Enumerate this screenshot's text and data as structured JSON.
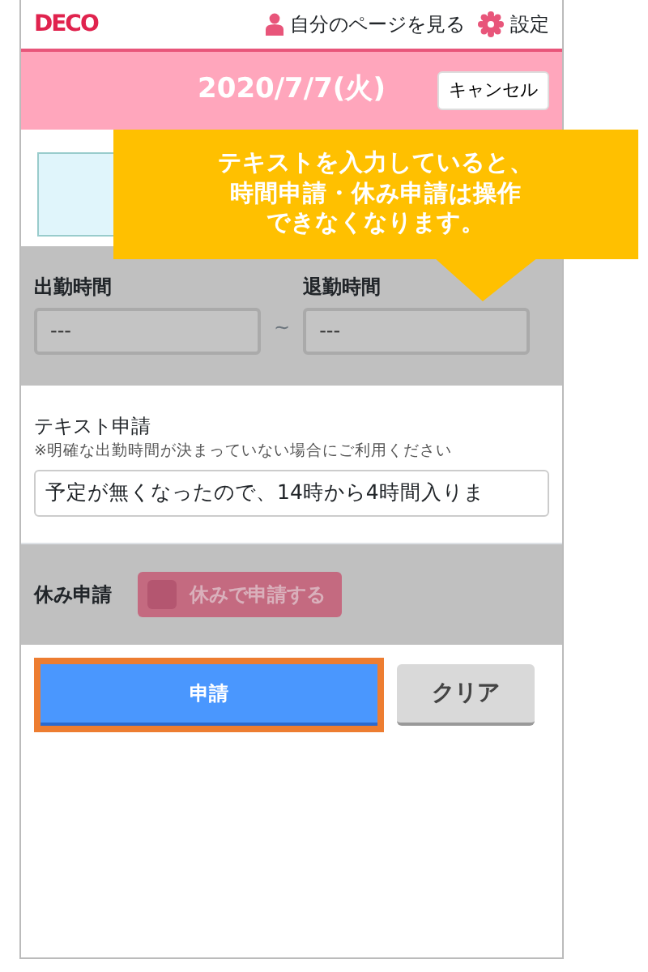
{
  "header": {
    "logo": "DECO",
    "my_page_link": "自分のページを見る",
    "settings_link": "設定"
  },
  "date_bar": {
    "date": "2020/7/7(火)",
    "cancel_button": "キャンセル"
  },
  "callout": {
    "lines": [
      "テキストを入力していると、",
      "時間申請・休み申請は操作",
      "できなくなります。"
    ]
  },
  "time_request": {
    "disabled": true,
    "start_label": "出勤時間",
    "start_value": "---",
    "separator": "~",
    "end_label": "退勤時間",
    "end_value": "---"
  },
  "text_request": {
    "label": "テキスト申請",
    "note": "※明確な出勤時間が決まっていない場合にご利用ください",
    "value": "予定が無くなったので、14時から4時間入りま"
  },
  "holiday_request": {
    "disabled": true,
    "label": "休み申請",
    "toggle": {
      "label": "休みで申請する",
      "checked": false
    }
  },
  "buttons": [
    {
      "kind": "submit",
      "label": "申請",
      "highlighted": true
    },
    {
      "kind": "clear",
      "label": "クリア",
      "highlighted": false
    }
  ]
}
